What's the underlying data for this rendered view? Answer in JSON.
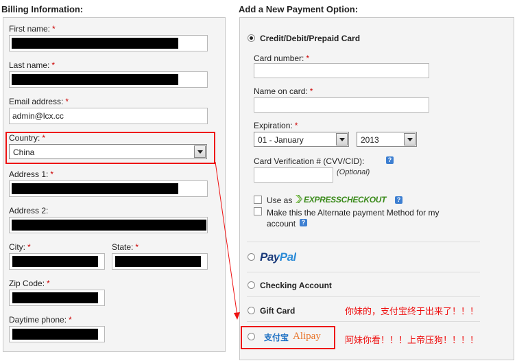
{
  "billing": {
    "heading": "Billing Information:",
    "first_name_label": "First name:",
    "last_name_label": "Last name:",
    "email_label": "Email address:",
    "email_value": "admin@lcx.cc",
    "country_label": "Country:",
    "country_value": "China",
    "address1_label": "Address 1:",
    "address2_label": "Address 2:",
    "city_label": "City:",
    "state_label": "State:",
    "zip_label": "Zip Code:",
    "phone_label": "Daytime phone:",
    "required_mark": "*"
  },
  "payment": {
    "heading": "Add a New Payment Option:",
    "card_option": "Credit/Debit/Prepaid Card",
    "card_number_label": "Card number:",
    "name_on_card_label": "Name on card:",
    "expiration_label": "Expiration:",
    "exp_month_value": "01 - January",
    "exp_year_value": "2013",
    "cvv_label": "Card Verification # (CVV/CID):",
    "cvv_optional": "(Optional)",
    "use_as_label": "Use as",
    "express_checkout_logo": "EXPRESSCHECKOUT",
    "alternate_label": "Make this the Alternate payment Method for my account",
    "paypal_logo": "PayPal",
    "checking_option": "Checking Account",
    "gift_card_option": "Gift Card",
    "alipay_logo_cn": "支付宝",
    "alipay_logo_en": "Alipay",
    "selected": "card"
  },
  "annotations": {
    "note_1": "你妹的，支付宝终于出来了！！！",
    "note_2": "阿妹你看！！！上帝压狗！！！！"
  },
  "colors": {
    "annotation_red": "#ee1111",
    "paypal_dark": "#1a3a7a",
    "paypal_light": "#2a8ad6",
    "express_green": "#3a8a1a",
    "alipay_orange": "#e8742a",
    "alipay_blue": "#1a6ec2"
  }
}
